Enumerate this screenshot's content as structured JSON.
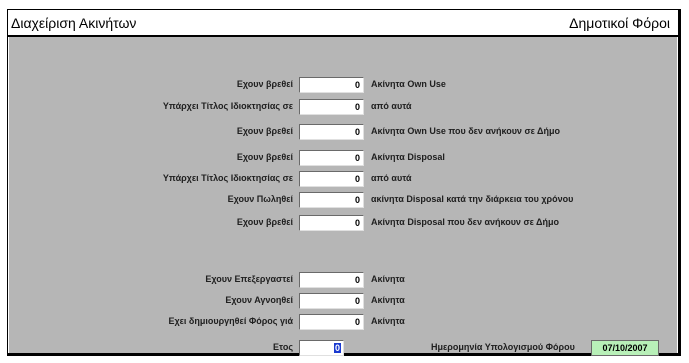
{
  "header": {
    "title": "Διαχείριση Ακινήτων",
    "section": "Δημοτικοί Φόροι"
  },
  "rows_top": [
    {
      "label": "Εχουν βρεθεί",
      "value": "0",
      "desc": "Ακίνητα Own Use"
    },
    {
      "label": "Υπάρχει Τίτλος Ιδιοκτησίας σε",
      "value": "0",
      "desc": "από αυτά"
    },
    {
      "label": "Εχουν βρεθεί",
      "value": "0",
      "desc": "Ακίνητα Own Use που  δεν ανήκουν σε Δήμο"
    },
    {
      "label": "Εχουν βρεθεί",
      "value": "0",
      "desc": "Ακίνητα Disposal"
    },
    {
      "label": "Υπάρχει Τίτλος Ιδιοκτησίας σε",
      "value": "0",
      "desc": "από αυτά"
    },
    {
      "label": "Εχουν Πωληθεί",
      "value": "0",
      "desc": "ακίνητα Disposal κατά την διάρκεια του χρόνου"
    },
    {
      "label": "Εχουν βρεθεί",
      "value": "0",
      "desc": "Ακίνητα Disposal που  δεν ανήκουν σε Δήμο"
    }
  ],
  "rows_bottom": [
    {
      "label": "Εχουν Επεξεργαστεί",
      "value": "0",
      "desc": "Ακίνητα"
    },
    {
      "label": "Εχουν Αγνοηθεί",
      "value": "0",
      "desc": "Ακίνητα"
    },
    {
      "label": "Εχει δημιουργηθεί Φόρος γιά",
      "value": "0",
      "desc": "Ακίνητα"
    }
  ],
  "year": {
    "label": "Ετος",
    "value": "0"
  },
  "calc_date": {
    "label": "Ημερομηνία Υπολογισμού Φόρου",
    "value": "07/10/2007"
  },
  "colors": {
    "panel": "#b6b6b6",
    "date_bg": "#b8f0b8",
    "selection": "#1a3ad0"
  }
}
